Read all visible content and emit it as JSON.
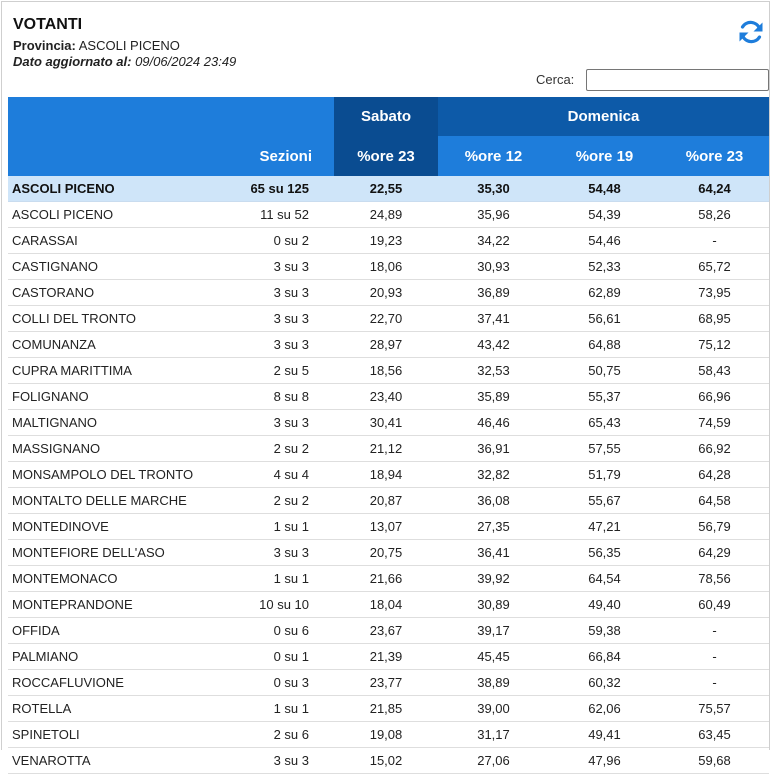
{
  "header": {
    "title": "VOTANTI",
    "provincia_label": "Provincia:",
    "provincia_value": "ASCOLI PICENO",
    "updated_label": "Dato aggiornato al:",
    "updated_value": "09/06/2024 23:49"
  },
  "refresh": {
    "icon": "refresh-icon",
    "color": "#1e7ddb"
  },
  "search": {
    "label": "Cerca:",
    "value": "",
    "placeholder": ""
  },
  "table": {
    "group_headers": {
      "sabato": "Sabato",
      "domenica": "Domenica"
    },
    "columns": [
      "",
      "Sezioni",
      "%ore 23",
      "%ore 12",
      "%ore 19",
      "%ore 23"
    ],
    "colors": {
      "header_blue": "#1e7ddb",
      "header_dark": "#0a4c91",
      "total_row_bg": "#cfe5f9"
    },
    "total": [
      "ASCOLI PICENO",
      "65 su 125",
      "22,55",
      "35,30",
      "54,48",
      "64,24"
    ],
    "rows": [
      [
        "ASCOLI PICENO",
        "11 su 52",
        "24,89",
        "35,96",
        "54,39",
        "58,26"
      ],
      [
        "CARASSAI",
        "0 su 2",
        "19,23",
        "34,22",
        "54,46",
        "-"
      ],
      [
        "CASTIGNANO",
        "3 su 3",
        "18,06",
        "30,93",
        "52,33",
        "65,72"
      ],
      [
        "CASTORANO",
        "3 su 3",
        "20,93",
        "36,89",
        "62,89",
        "73,95"
      ],
      [
        "COLLI DEL TRONTO",
        "3 su 3",
        "22,70",
        "37,41",
        "56,61",
        "68,95"
      ],
      [
        "COMUNANZA",
        "3 su 3",
        "28,97",
        "43,42",
        "64,88",
        "75,12"
      ],
      [
        "CUPRA MARITTIMA",
        "2 su 5",
        "18,56",
        "32,53",
        "50,75",
        "58,43"
      ],
      [
        "FOLIGNANO",
        "8 su 8",
        "23,40",
        "35,89",
        "55,37",
        "66,96"
      ],
      [
        "MALTIGNANO",
        "3 su 3",
        "30,41",
        "46,46",
        "65,43",
        "74,59"
      ],
      [
        "MASSIGNANO",
        "2 su 2",
        "21,12",
        "36,91",
        "57,55",
        "66,92"
      ],
      [
        "MONSAMPOLO DEL TRONTO",
        "4 su 4",
        "18,94",
        "32,82",
        "51,79",
        "64,28"
      ],
      [
        "MONTALTO DELLE MARCHE",
        "2 su 2",
        "20,87",
        "36,08",
        "55,67",
        "64,58"
      ],
      [
        "MONTEDINOVE",
        "1 su 1",
        "13,07",
        "27,35",
        "47,21",
        "56,79"
      ],
      [
        "MONTEFIORE DELL'ASO",
        "3 su 3",
        "20,75",
        "36,41",
        "56,35",
        "64,29"
      ],
      [
        "MONTEMONACO",
        "1 su 1",
        "21,66",
        "39,92",
        "64,54",
        "78,56"
      ],
      [
        "MONTEPRANDONE",
        "10 su 10",
        "18,04",
        "30,89",
        "49,40",
        "60,49"
      ],
      [
        "OFFIDA",
        "0 su 6",
        "23,67",
        "39,17",
        "59,38",
        "-"
      ],
      [
        "PALMIANO",
        "0 su 1",
        "21,39",
        "45,45",
        "66,84",
        "-"
      ],
      [
        "ROCCAFLUVIONE",
        "0 su 3",
        "23,77",
        "38,89",
        "60,32",
        "-"
      ],
      [
        "ROTELLA",
        "1 su 1",
        "21,85",
        "39,00",
        "62,06",
        "75,57"
      ],
      [
        "SPINETOLI",
        "2 su 6",
        "19,08",
        "31,17",
        "49,41",
        "63,45"
      ],
      [
        "VENAROTTA",
        "3 su 3",
        "15,02",
        "27,06",
        "47,96",
        "59,68"
      ]
    ]
  }
}
